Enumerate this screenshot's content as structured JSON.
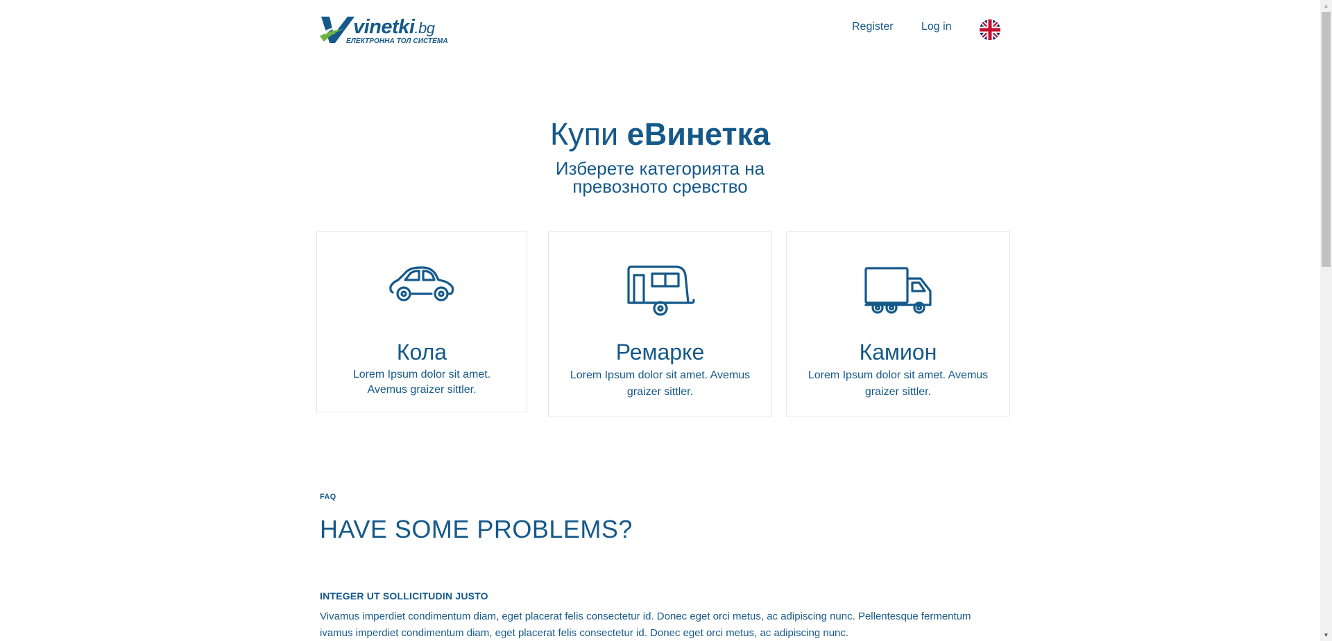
{
  "header": {
    "logo_word": "vinetki",
    "logo_tld": ".bg",
    "logo_tagline": "ЕЛЕКТРОННА ТОЛ СИСТЕМА",
    "register_label": "Register",
    "login_label": "Log in",
    "language_icon": "uk-flag-icon"
  },
  "hero": {
    "title_regular": "Купи ",
    "title_bold": "еВинетка",
    "subtitle_line1": "Изберете категорията на",
    "subtitle_line2": "превозното сревство"
  },
  "categories": [
    {
      "icon": "car-icon",
      "title": "Кола",
      "description": "Lorem Ipsum dolor sit amet. Avemus graizer sittler."
    },
    {
      "icon": "trailer-icon",
      "title": "Ремарке",
      "description": "Lorem Ipsum dolor sit amet. Avemus graizer sittler."
    },
    {
      "icon": "truck-icon",
      "title": "Камион",
      "description": "Lorem Ipsum dolor sit amet. Avemus graizer sittler."
    }
  ],
  "faq": {
    "kicker": "FAQ",
    "title": "HAVE SOME PROBLEMS?",
    "question": "INTEGER UT SOLLICITUDIN JUSTO",
    "answer_line1": "Vivamus imperdiet condimentum diam, eget placerat felis consectetur id. Donec eget orci metus, ac adipiscing nunc. Pellentesque fermentum",
    "answer_line2": "ivamus imperdiet condimentum diam, eget placerat felis consectetur id. Donec eget orci metus, ac adipiscing nunc."
  },
  "colors": {
    "brand_blue": "#15598a",
    "brand_green": "#6cb33f",
    "card_border": "#e3e6ea"
  }
}
